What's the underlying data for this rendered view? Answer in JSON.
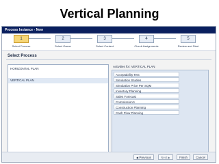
{
  "slide": {
    "title": "Vertical Planning"
  },
  "window": {
    "title": "Process Instance - New"
  },
  "steps": [
    {
      "number": "1",
      "label": "Select Process",
      "active": true
    },
    {
      "number": "2",
      "label": "Select Owner",
      "active": false
    },
    {
      "number": "3",
      "label": "Select Context",
      "active": false
    },
    {
      "number": "4",
      "label": "Check Assignments",
      "active": false
    },
    {
      "number": "5",
      "label": "Review and Start",
      "active": false
    }
  ],
  "section": {
    "title": "Select Process"
  },
  "processes": [
    {
      "label": "HORIZONTAL PLAN",
      "selected": false
    },
    {
      "label": "VERTICAL PLAN",
      "selected": true
    }
  ],
  "activities": {
    "label": "Activities for: VERTICAL PLAN",
    "items": [
      "Acceptability Test",
      "Simulation Studies",
      "Simulation Price Per SQM",
      "Inventory Planning",
      "Sales Forecast",
      "Commission's",
      "Construction Planning",
      "Cash Flow Planning"
    ]
  },
  "buttons": {
    "previous": "Previous",
    "next": "Next",
    "finish": "Finish",
    "cancel": "Cancel"
  },
  "colors": {
    "titlebar": "#0a1f5e",
    "active_step": "#f7d778",
    "list_bg": "#dde6f2"
  }
}
